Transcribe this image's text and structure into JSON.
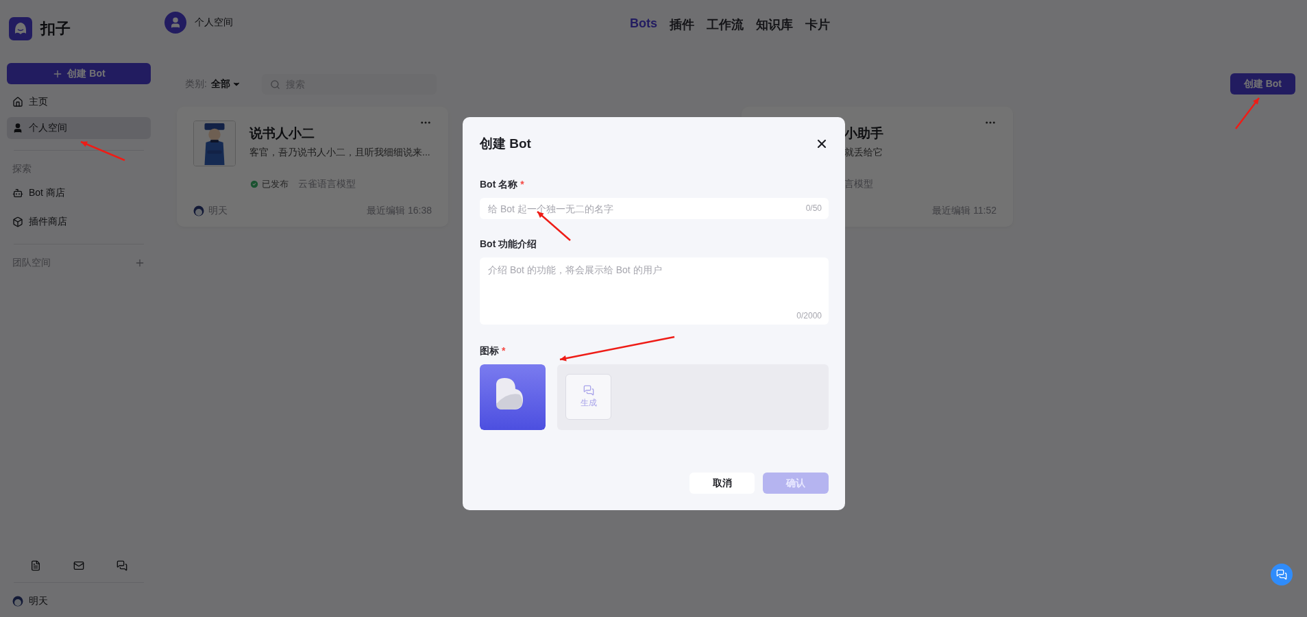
{
  "sidebar": {
    "brand": "扣子",
    "create_button": "创建 Bot",
    "nav": [
      {
        "label": "主页",
        "selected": false
      },
      {
        "label": "个人空间",
        "selected": true
      }
    ],
    "explore": {
      "title": "探索",
      "items": [
        "Bot 商店",
        "插件商店"
      ]
    },
    "team": {
      "title": "团队空间"
    },
    "user": "明天"
  },
  "header": {
    "workspace": "个人空间",
    "tabs": [
      {
        "label": "Bots",
        "selected": true
      },
      {
        "label": "插件",
        "selected": false
      },
      {
        "label": "工作流",
        "selected": false
      },
      {
        "label": "知识库",
        "selected": false
      },
      {
        "label": "卡片",
        "selected": false
      }
    ]
  },
  "toolbar": {
    "category_label": "类别:",
    "category_value": "全部",
    "search_placeholder": "搜索",
    "create_button": "创建 Bot"
  },
  "bots": [
    {
      "kind": "full",
      "name": "说书人小二",
      "description": "客官，吾乃说书人小二，且听我细细说来...",
      "status": "已发布",
      "model": "云雀语言模型",
      "owner": "明天",
      "edited": "最近编辑 16:38"
    },
    {
      "kind": "partial",
      "name": "小助手",
      "description": "就丢给它",
      "model": "言模型",
      "edited": "最近编辑 11:52"
    }
  ],
  "dialog": {
    "title": "创建 Bot",
    "name_label": "Bot 名称",
    "name_marker": "*",
    "name_placeholder": "给 Bot 起一个独一无二的名字",
    "name_count": "0/50",
    "intro_label": "Bot 功能介绍",
    "intro_placeholder": "介绍 Bot 的功能，将会展示给 Bot 的用户",
    "intro_count": "0/2000",
    "icon_label": "图标",
    "icon_marker": "*",
    "generate_label": "生成",
    "cancel": "取消",
    "confirm": "确认",
    "confirm_disabled": true
  },
  "annotations": [
    {
      "kind": "arrow"
    },
    {
      "kind": "arrow"
    },
    {
      "kind": "arrow"
    },
    {
      "kind": "arrow"
    }
  ]
}
